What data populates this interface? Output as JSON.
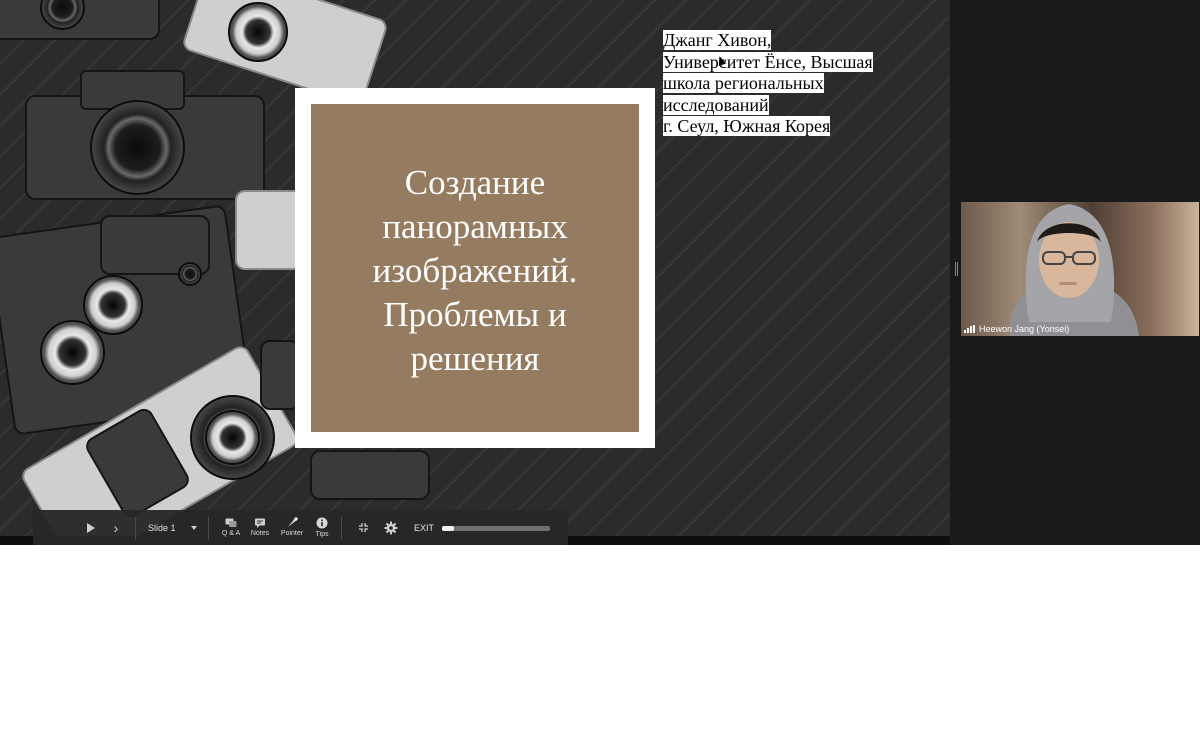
{
  "slide": {
    "title": "Создание панорамных изображений. Проблемы и решения",
    "author_lines": [
      "Джанг Хивон,",
      "Университет Ёнсе, Высшая",
      "школа региональных",
      "исследований",
      "г. Сеул, Южная Корея"
    ],
    "title_box_color": "#957c61"
  },
  "toolbar": {
    "slide_select": "Slide 1",
    "qa_label": "Q & A",
    "notes_label": "Notes",
    "pointer_label": "Pointer",
    "tips_label": "Tips",
    "exit_label": "EXIT",
    "progress": 0.11
  },
  "participant": {
    "name": "Heewon Jang (Yonsei)"
  },
  "icons": [
    "play-icon",
    "next-icon",
    "dropdown-arrow-icon",
    "qa-icon",
    "notes-icon",
    "pointer-icon",
    "info-icon",
    "exit-fullscreen-icon",
    "settings-gear-icon",
    "signal-icon"
  ]
}
